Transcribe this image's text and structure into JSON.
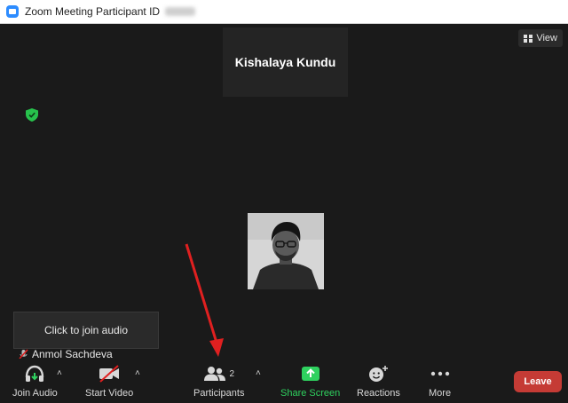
{
  "window": {
    "title": "Zoom Meeting Participant ID"
  },
  "view_button": {
    "label": "View",
    "icon": "grid-view-icon"
  },
  "speaker_tile": {
    "name": "Kishalaya Kundu"
  },
  "audio_popup": {
    "text": "Click to join audio"
  },
  "self_tile": {
    "name": "Anmol Sachdeva",
    "icon": "muted-mic-icon"
  },
  "toolbar": {
    "join_audio": "Join Audio",
    "start_video": "Start Video",
    "participants": "Participants",
    "participants_count": "2",
    "share_screen": "Share Screen",
    "reactions": "Reactions",
    "more": "More",
    "leave": "Leave"
  },
  "colors": {
    "share_green": "#2fd15f",
    "leave_red": "#c53b35",
    "arrow_red": "#e02020",
    "shield_green": "#27c24c"
  }
}
